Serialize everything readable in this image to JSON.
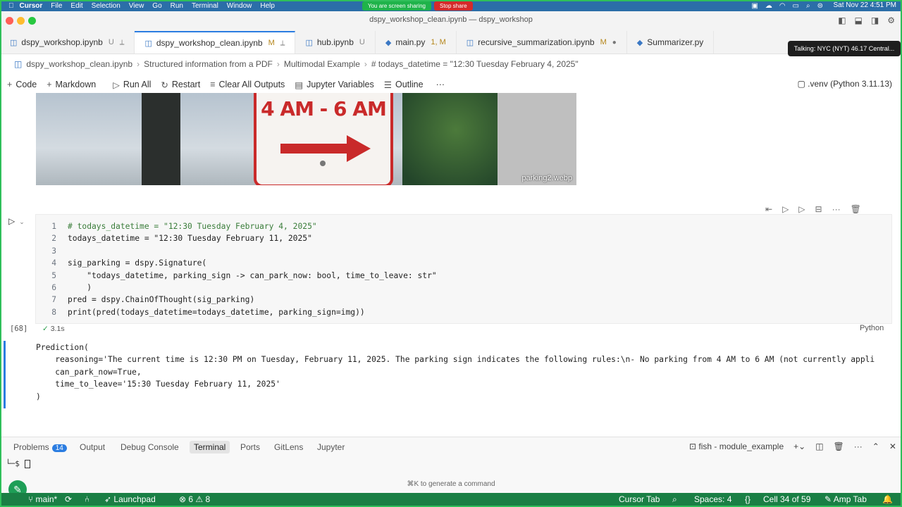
{
  "menubar": {
    "app": "Cursor",
    "items": [
      "File",
      "Edit",
      "Selection",
      "View",
      "Go",
      "Run",
      "Terminal",
      "Window",
      "Help"
    ],
    "sharing_text": "You are screen sharing",
    "stop_share": "Stop share",
    "datetime": "Sat Nov 22  4:51 PM"
  },
  "window": {
    "title": "dspy_workshop_clean.ipynb — dspy_workshop"
  },
  "tabs": [
    {
      "label": "dspy_workshop.ipynb",
      "mod": "U"
    },
    {
      "label": "dspy_workshop_clean.ipynb",
      "mod": "M"
    },
    {
      "label": "hub.ipynb",
      "mod": "U"
    },
    {
      "label": "main.py",
      "mod": "1, M"
    },
    {
      "label": "recursive_summarization.ipynb",
      "mod": "M"
    },
    {
      "label": "Summarizer.py",
      "mod": ""
    }
  ],
  "tooltip": "Talking: NYC (NYT) 46.17 Central...",
  "breadcrumbs": [
    "dspy_workshop_clean.ipynb",
    "Structured information from a PDF",
    "Multimodal Example",
    "# todays_datetime = \"12:30 Tuesday February 4, 2025\""
  ],
  "toolbar": {
    "code": "Code",
    "markdown": "Markdown",
    "run_all": "Run All",
    "restart": "Restart",
    "clear": "Clear All Outputs",
    "variables": "Jupyter Variables",
    "outline": "Outline",
    "more": "···",
    "kernel": ".venv (Python 3.11.13)"
  },
  "image": {
    "sign_text": "4 AM - 6 AM",
    "label": "parking2.webp"
  },
  "cell": {
    "lines": [
      {
        "n": "1",
        "text": "# todays_datetime = \"12:30 Tuesday February 4, 2025\""
      },
      {
        "n": "2",
        "text": "todays_datetime = \"12:30 Tuesday February 11, 2025\""
      },
      {
        "n": "3",
        "text": ""
      },
      {
        "n": "4",
        "text": "sig_parking = dspy.Signature("
      },
      {
        "n": "5",
        "text": "    \"todays_datetime, parking_sign -> can_park_now: bool, time_to_leave: str\""
      },
      {
        "n": "6",
        "text": "    )"
      },
      {
        "n": "7",
        "text": "pred = dspy.ChainOfThought(sig_parking)"
      },
      {
        "n": "8",
        "text": "print(pred(todays_datetime=todays_datetime, parking_sign=img))"
      }
    ],
    "exec_count": "[68]",
    "exec_time": "3.1s",
    "language": "Python"
  },
  "output": {
    "lines": [
      "Prediction(",
      "    reasoning='The current time is 12:30 PM on Tuesday, February 11, 2025. The parking sign indicates the following rules:\\n- No parking from 4 AM to 6 AM (not currently appli",
      "    can_park_now=True,",
      "    time_to_leave='15:30 Tuesday February 11, 2025'",
      ")"
    ]
  },
  "panel": {
    "tabs": [
      "Problems",
      "Output",
      "Debug Console",
      "Terminal",
      "Ports",
      "GitLens",
      "Jupyter"
    ],
    "problems_count": "14",
    "shell": "fish - module_example",
    "prompt": "└─$",
    "hint": "⌘K to generate a command"
  },
  "statusbar": {
    "branch": "main*",
    "launchpad": "Launchpad",
    "errors": "6",
    "warnings": "8",
    "cursor_tab": "Cursor Tab",
    "spaces": "Spaces: 4",
    "braces": "{}",
    "cell": "Cell 34 of 59",
    "amp": "Amp Tab"
  },
  "colors": {
    "accent": "#2b7de1",
    "statusbar": "#1a7f45",
    "share_green": "#1fb34a",
    "stop_red": "#d52a2a"
  }
}
